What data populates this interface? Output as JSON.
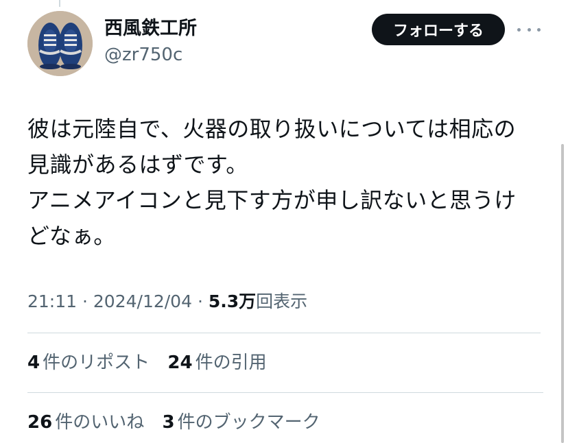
{
  "user": {
    "display_name": "西風鉄工所",
    "handle": "@zr750c",
    "avatar_icon": "sneakers-photo-icon"
  },
  "header": {
    "follow_label": "フォローする",
    "more_icon": "more-horizontal-icon"
  },
  "tweet": {
    "text": "彼は元陸自で、火器の取り扱いについては相応の\n見識があるはずです。\nアニメアイコンと見下す方が申し訳ないと思うけ\nどなぁ。"
  },
  "meta": {
    "time": "21:11",
    "separator": "·",
    "date": "2024/12/04",
    "views_count": "5.3万",
    "views_label": "回表示"
  },
  "stats": {
    "reposts_count": "4",
    "reposts_label": "件のリポスト",
    "quotes_count": "24",
    "quotes_label": "件の引用",
    "likes_count": "26",
    "likes_label": "件のいいね",
    "bookmarks_count": "3",
    "bookmarks_label": "件のブックマーク"
  },
  "colors": {
    "text": "#0f1419",
    "secondary": "#536471",
    "divider": "#cfd9de",
    "button_bg": "#0f1419",
    "button_text": "#ffffff"
  }
}
